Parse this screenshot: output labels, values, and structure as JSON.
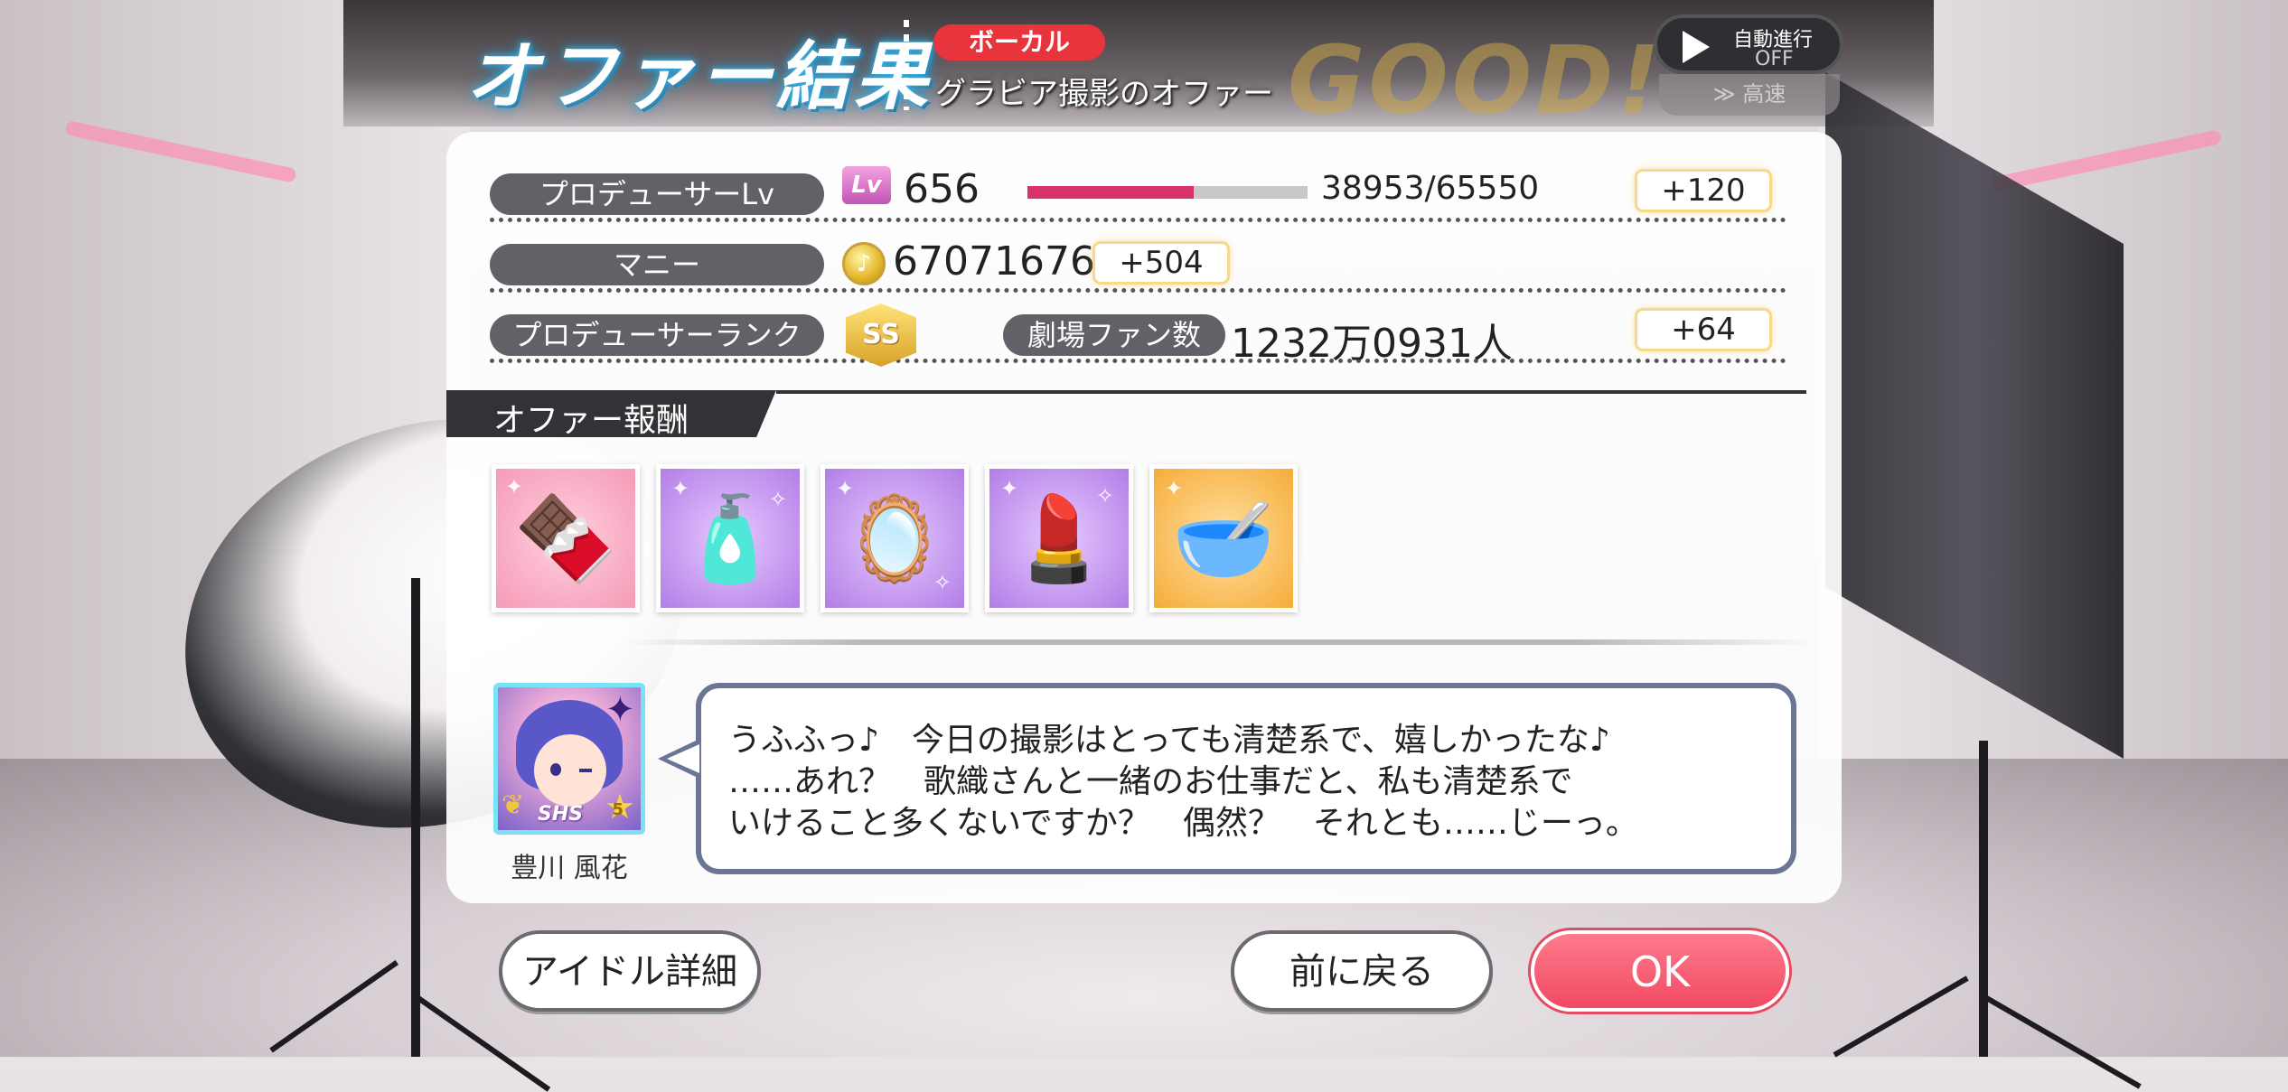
{
  "header": {
    "title": "オファー結果",
    "category_badge": "ボーカル",
    "offer_name": "グラビア撮影のオファー",
    "grade": "GOOD!",
    "auto_label": "自動進行",
    "auto_state": "OFF",
    "speed_label": "≫ 高速"
  },
  "stats": {
    "producer_lv_label": "プロデューサーLv",
    "lv_icon": "Lv",
    "level": "656",
    "exp_text": "38953/65550",
    "exp_fraction": 0.594,
    "exp_gain": "+120",
    "money_label": "マニー",
    "money": "67071676",
    "money_gain": "+504",
    "rank_label": "プロデューサーランク",
    "rank": "SS",
    "fans_label": "劇場ファン数",
    "fans": "1232万0931人",
    "fans_gain": "+64"
  },
  "rewards": {
    "header": "オファー報酬",
    "items": [
      {
        "name": "chocolate-icon",
        "glyph": "🍫",
        "bg": "pink"
      },
      {
        "name": "perfume-bottle-icon",
        "glyph": "🧴",
        "bg": "purple"
      },
      {
        "name": "hand-mirror-icon",
        "glyph": "🪞",
        "bg": "purple"
      },
      {
        "name": "lipstick-icon",
        "glyph": "💄",
        "bg": "purple"
      },
      {
        "name": "cream-jar-icon",
        "glyph": "🥣",
        "bg": "orange"
      }
    ]
  },
  "dialogue": {
    "idol_name": "豊川 風花",
    "card_rarity": "SHS",
    "card_level": "5",
    "lines": [
      "うふふっ♪　今日の撮影はとっても清楚系で、嬉しかったな♪",
      "……あれ？　歌織さんと一緒のお仕事だと、私も清楚系で",
      "いけること多くないですか？　偶然？　それとも……じーっ。"
    ]
  },
  "buttons": {
    "idol_detail": "アイドル詳細",
    "back": "前に戻る",
    "ok": "OK"
  },
  "colors": {
    "vocal_badge": "#e8343c",
    "exp_fill": "#d6336c",
    "ok_button": "#f04a62",
    "pill": "#606268"
  }
}
